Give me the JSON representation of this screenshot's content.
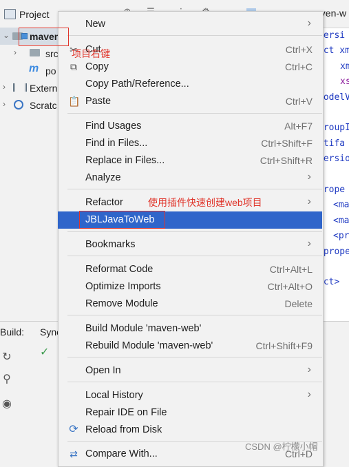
{
  "project_panel": {
    "title": "Project",
    "tree": [
      {
        "label": "maven",
        "level": 0
      },
      {
        "label": "src",
        "level": 1
      },
      {
        "label": "po",
        "level": 1
      },
      {
        "label": "Extern",
        "level": 0
      },
      {
        "label": "Scratc",
        "level": 0
      }
    ]
  },
  "editor": {
    "tab_label": "aven-w",
    "code_lines": [
      {
        "text": "versi",
        "color": "blue"
      },
      {
        "text": "ect xm",
        "color": "blue"
      },
      {
        "text": "xm",
        "color": "blue"
      },
      {
        "text": "xs",
        "color": "purple"
      },
      {
        "text": "nodelV",
        "color": "blue"
      },
      {
        "text": "",
        "color": "dark"
      },
      {
        "text": "groupI",
        "color": "blue"
      },
      {
        "text": "rtifa",
        "color": "blue"
      },
      {
        "text": "versio",
        "color": "blue"
      },
      {
        "text": "",
        "color": "dark"
      },
      {
        "text": "prope",
        "color": "blue"
      },
      {
        "text": "<ma",
        "color": "blue"
      },
      {
        "text": "<ma",
        "color": "blue"
      },
      {
        "text": "<pr",
        "color": "blue"
      },
      {
        "text": "/prope",
        "color": "blue"
      },
      {
        "text": "",
        "color": "dark"
      },
      {
        "text": "ect>",
        "color": "blue"
      }
    ]
  },
  "build_panel": {
    "label": "Build:",
    "tab": "Sync"
  },
  "annotations": {
    "right_click_note": "项目右键",
    "plugin_note": "使用插件快速创建web项目"
  },
  "context_menu": {
    "items": [
      {
        "label": "New",
        "shortcut": "",
        "submenu": true,
        "icon": ""
      },
      {
        "label": "Cut",
        "shortcut": "Ctrl+X",
        "submenu": false,
        "icon": "scissors-icon"
      },
      {
        "label": "Copy",
        "shortcut": "Ctrl+C",
        "submenu": false,
        "icon": "copy-icon"
      },
      {
        "label": "Copy Path/Reference...",
        "shortcut": "",
        "submenu": false,
        "icon": ""
      },
      {
        "label": "Paste",
        "shortcut": "Ctrl+V",
        "submenu": false,
        "icon": "paste-icon"
      },
      {
        "label": "Find Usages",
        "shortcut": "Alt+F7",
        "submenu": false,
        "icon": ""
      },
      {
        "label": "Find in Files...",
        "shortcut": "Ctrl+Shift+F",
        "submenu": false,
        "icon": ""
      },
      {
        "label": "Replace in Files...",
        "shortcut": "Ctrl+Shift+R",
        "submenu": false,
        "icon": ""
      },
      {
        "label": "Analyze",
        "shortcut": "",
        "submenu": true,
        "icon": ""
      },
      {
        "label": "Refactor",
        "shortcut": "",
        "submenu": true,
        "icon": ""
      },
      {
        "label": "JBLJavaToWeb",
        "shortcut": "",
        "submenu": false,
        "icon": "",
        "selected": true
      },
      {
        "label": "Bookmarks",
        "shortcut": "",
        "submenu": true,
        "icon": ""
      },
      {
        "label": "Reformat Code",
        "shortcut": "Ctrl+Alt+L",
        "submenu": false,
        "icon": ""
      },
      {
        "label": "Optimize Imports",
        "shortcut": "Ctrl+Alt+O",
        "submenu": false,
        "icon": ""
      },
      {
        "label": "Remove Module",
        "shortcut": "Delete",
        "submenu": false,
        "icon": ""
      },
      {
        "label": "Build Module 'maven-web'",
        "shortcut": "",
        "submenu": false,
        "icon": ""
      },
      {
        "label": "Rebuild Module 'maven-web'",
        "shortcut": "Ctrl+Shift+F9",
        "submenu": false,
        "icon": ""
      },
      {
        "label": "Open In",
        "shortcut": "",
        "submenu": true,
        "icon": ""
      },
      {
        "label": "Local History",
        "shortcut": "",
        "submenu": true,
        "icon": ""
      },
      {
        "label": "Repair IDE on File",
        "shortcut": "",
        "submenu": false,
        "icon": ""
      },
      {
        "label": "Reload from Disk",
        "shortcut": "",
        "submenu": false,
        "icon": "reload-icon"
      },
      {
        "label": "Compare With...",
        "shortcut": "Ctrl+D",
        "submenu": false,
        "icon": "compare-icon"
      }
    ]
  },
  "watermark": "CSDN @柠檬小帽"
}
